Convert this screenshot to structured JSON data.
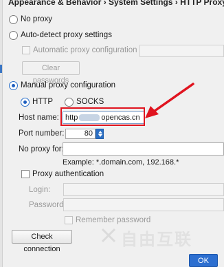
{
  "breadcrumb": "Appearance & Behavior › System Settings › HTTP Proxy",
  "proxy_mode": {
    "no_proxy": "No proxy",
    "auto_detect": "Auto-detect proxy settings",
    "auto_config_url": "Automatic proxy configuration URL:",
    "clear_passwords": "Clear passwords",
    "manual": "Manual proxy configuration",
    "selected": "manual"
  },
  "manual": {
    "protocol_http": "HTTP",
    "protocol_socks": "SOCKS",
    "selected_protocol": "HTTP",
    "host_label": "Host name:",
    "host_value_prefix": "http",
    "host_value_suffix": "opencas.cn",
    "port_label": "Port number:",
    "port_value": "80",
    "no_proxy_label": "No proxy for:",
    "no_proxy_value": "",
    "example": "Example: *.domain.com, 192.168.*",
    "proxy_auth": "Proxy authentication",
    "login_label": "Login:",
    "password_label": "Password:",
    "remember_password": "Remember password"
  },
  "footer": {
    "check_connection": "Check connection",
    "ok": "OK"
  },
  "watermark_text": "自由互联",
  "colors": {
    "accent": "#2d6fd0",
    "highlight": "#e0141f"
  }
}
